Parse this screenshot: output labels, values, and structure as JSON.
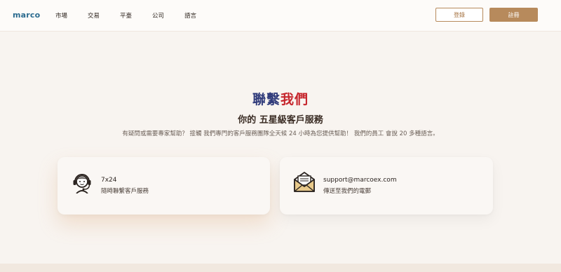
{
  "nav": {
    "logo": "marco",
    "items": [
      "市場",
      "交易",
      "平臺",
      "公司",
      "語言"
    ],
    "login_label": "登錄",
    "register_label": "註冊"
  },
  "hero": {
    "title_part1": "聯繫",
    "title_part2": "我們",
    "subtitle": "你的 五星級客戶服務",
    "description": "有疑問或需要專家幫助？ 接觸 我們專門的客戶服務團隊全天候 24 小時為您提供幫助！ 我們的員工 會說 20 多種語言。"
  },
  "cards": [
    {
      "icon": "headset-icon",
      "line1": "7x24",
      "line2": "隨時聯繫客戶服務"
    },
    {
      "icon": "envelope-icon",
      "line1": "support@marcoex.com",
      "line2": "傳送至我們的電郵"
    }
  ],
  "colors": {
    "accent": "#b78a5c",
    "title_blue": "#2f3a7a",
    "title_red": "#c6262d",
    "background": "#f8f4f0"
  }
}
